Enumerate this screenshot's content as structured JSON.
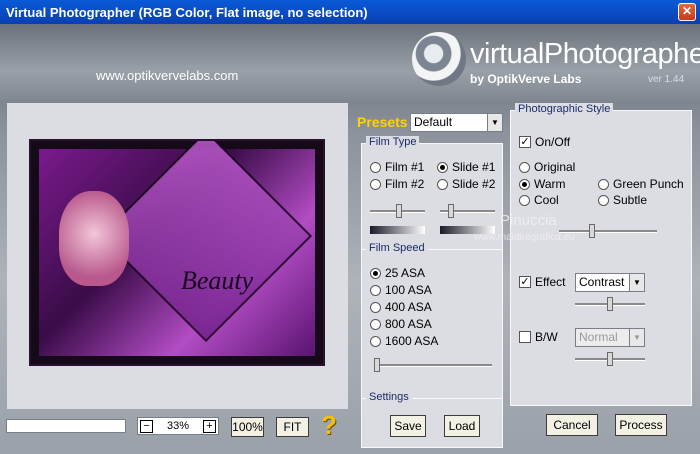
{
  "window": {
    "title": "Virtual Photographer (RGB Color, Flat image, no selection)",
    "close_label": "✕"
  },
  "header": {
    "url": "www.optikvervelabs.com",
    "logo_main": "virtualPhotographer",
    "logo_sub": "by OptikVerve Labs",
    "version": "ver 1.44"
  },
  "preview": {
    "caption": "Beauty"
  },
  "zoom": {
    "minus": "−",
    "plus": "+",
    "value": "33%",
    "btn_100": "100%",
    "btn_fit": "FIT",
    "help": "?"
  },
  "presets": {
    "label": "Presets",
    "value": "Default"
  },
  "film_type": {
    "title": "Film Type",
    "options": [
      {
        "label": "Film #1",
        "selected": false
      },
      {
        "label": "Slide #1",
        "selected": true
      },
      {
        "label": "Film #2",
        "selected": false
      },
      {
        "label": "Slide #2",
        "selected": false
      }
    ]
  },
  "film_speed": {
    "title": "Film Speed",
    "options": [
      {
        "label": "25 ASA",
        "selected": true
      },
      {
        "label": "100 ASA",
        "selected": false
      },
      {
        "label": "400 ASA",
        "selected": false
      },
      {
        "label": "800 ASA",
        "selected": false
      },
      {
        "label": "1600 ASA",
        "selected": false
      }
    ]
  },
  "settings": {
    "title": "Settings",
    "save": "Save",
    "load": "Load"
  },
  "style": {
    "title": "Photographic Style",
    "onoff": "On/Off",
    "options": [
      {
        "label": "Original",
        "selected": false
      },
      {
        "label": "Warm",
        "selected": true
      },
      {
        "label": "Green Punch",
        "selected": false
      },
      {
        "label": "Cool",
        "selected": false
      },
      {
        "label": "Subtle",
        "selected": false
      }
    ],
    "watermark": "Pinuccia",
    "watermark_url": "www.maidiregrafica.eu",
    "effect_label": "Effect",
    "effect_value": "Contrast",
    "bw_label": "B/W",
    "bw_value": "Normal"
  },
  "actions": {
    "cancel": "Cancel",
    "process": "Process"
  },
  "colors": {
    "titlebar": "#0a4ac8",
    "presets_label": "#ffd400",
    "help": "#f4c010"
  }
}
